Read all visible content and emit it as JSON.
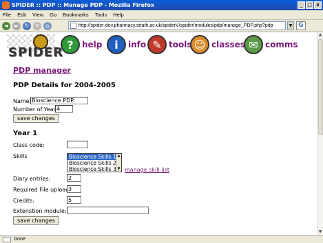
{
  "window": {
    "title": "SPIDER :: PDP :: Manage PDP - Mozilla Firefox",
    "buttons": [
      "_",
      "□",
      "x"
    ]
  },
  "menu": [
    "File",
    "Edit",
    "View",
    "Go",
    "Bookmarks",
    "Tools",
    "Help"
  ],
  "address": {
    "url": "http://spider-dev.pharmacy.strath.ac.uk/spiderV/spider/modules/pdp/manage_PDP.php?pdp",
    "go_label": "G"
  },
  "site_nav": {
    "logo": "SPIDER",
    "items": [
      {
        "label": "help",
        "icon": "?",
        "color": "#2e9a3a"
      },
      {
        "label": "info",
        "icon": "i",
        "color": "#1f5fbf"
      },
      {
        "label": "tools",
        "icon": "✎",
        "color": "#c0392b"
      },
      {
        "label": "classes",
        "icon": "☺",
        "color": "#d98c2b"
      },
      {
        "label": "comms",
        "icon": "✉",
        "color": "#5a9a4a"
      }
    ]
  },
  "page": {
    "heading": "PDP manager",
    "details_title": "PDP Details for 2004-2005",
    "name_label": "Name:",
    "name_value": "Bioscience PDP",
    "years_label": "Number of Years:",
    "years_value": "4",
    "save_label": "save changes",
    "year_title": "Year 1",
    "class_code_label": "Class code:",
    "class_code_value": "",
    "skills_label": "Skills",
    "skills_options": [
      "Bioscience Skills 1",
      "Bioscience Skills 2",
      "Bioscience Skills 3"
    ],
    "skills_selected": "Bioscience Skills 1",
    "manage_skills_link": "manage skill list",
    "diary_label": "Diary entries:",
    "diary_value": "2",
    "uploads_label": "Required File uploads:",
    "uploads_value": "3",
    "credits_label": "Credits:",
    "credits_value": "5",
    "extension_label": "Extenstion module:",
    "extension_value": "",
    "save2_label": "save changes"
  },
  "status": {
    "text": "Done"
  }
}
